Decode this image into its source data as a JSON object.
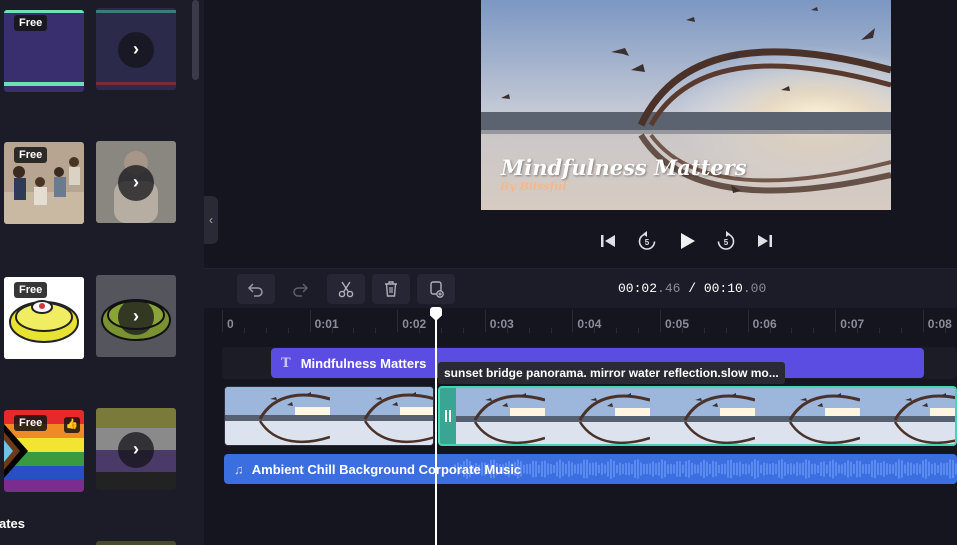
{
  "assets": {
    "badges": {
      "free": "Free"
    },
    "more_label": "›",
    "section_heading": "ates"
  },
  "preview": {
    "overlay_title": "Mindfulness Matters",
    "overlay_subtitle": "By Blissful"
  },
  "playback": {
    "icons": [
      "skip-to-start-icon",
      "rewind-5s-icon",
      "play-icon",
      "forward-5s-icon",
      "skip-to-end-icon"
    ],
    "rewind_label": "5",
    "forward_label": "5"
  },
  "toolbar": {
    "icons": [
      "undo-icon",
      "redo-icon",
      "split-icon",
      "delete-icon",
      "duplicate-icon"
    ],
    "time_current_main": "00:02",
    "time_current_frac": ".46",
    "time_separator": " / ",
    "time_total_main": "00:10",
    "time_total_frac": ".00"
  },
  "timeline": {
    "ruler": [
      "0",
      "0:01",
      "0:02",
      "0:03",
      "0:04",
      "0:05",
      "0:06",
      "0:07",
      "0:08"
    ],
    "text_track": {
      "icon_glyph": "T",
      "label": "Mindfulness Matters"
    },
    "video_tooltip": "sunset bridge panorama. mirror water reflection.slow mo...",
    "audio_track": {
      "icon_glyph": "♫",
      "label": "Ambient Chill Background Corporate Music"
    },
    "playhead_time": "0:02.46"
  },
  "colors": {
    "accent_text_clip": "#5b4de2",
    "accent_audio_clip": "#3b6fe0",
    "selected_clip_border": "#43d4b4"
  }
}
